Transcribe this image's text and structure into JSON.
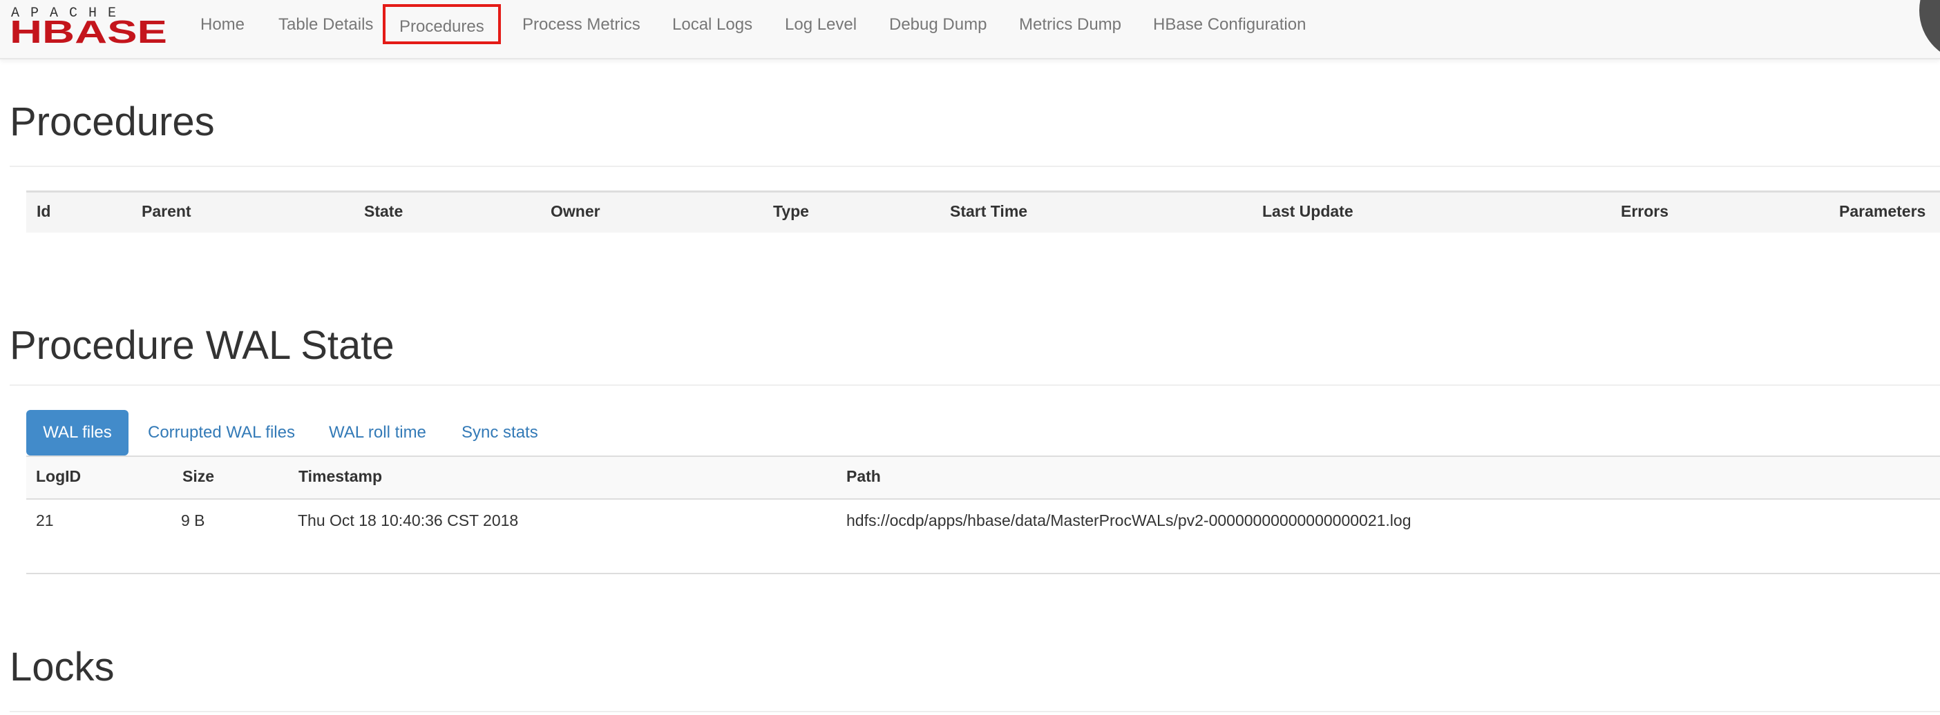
{
  "logo": {
    "top_text": "APACHE",
    "main_text": "HBASE",
    "brand_color": "#c4151c"
  },
  "nav": {
    "items": [
      {
        "label": "Home"
      },
      {
        "label": "Table Details"
      },
      {
        "label": "Procedures",
        "active": true
      },
      {
        "label": "Process Metrics"
      },
      {
        "label": "Local Logs"
      },
      {
        "label": "Log Level"
      },
      {
        "label": "Debug Dump"
      },
      {
        "label": "Metrics Dump"
      },
      {
        "label": "HBase Configuration"
      }
    ],
    "active_highlight_color": "#e41b17"
  },
  "procedures": {
    "heading": "Procedures",
    "columns": [
      "Id",
      "Parent",
      "State",
      "Owner",
      "Type",
      "Start Time",
      "Last Update",
      "Errors",
      "Parameters"
    ],
    "rows": []
  },
  "wal_state": {
    "heading": "Procedure WAL State",
    "tabs": [
      {
        "label": "WAL files",
        "active": true
      },
      {
        "label": "Corrupted WAL files"
      },
      {
        "label": "WAL roll time"
      },
      {
        "label": "Sync stats"
      }
    ],
    "tab_active_color": "#428bca",
    "columns": [
      "LogID",
      "Size",
      "Timestamp",
      "Path"
    ],
    "rows": [
      {
        "log_id": "21",
        "size": "9 B",
        "timestamp": "Thu Oct 18 10:40:36 CST 2018",
        "path": "hdfs://ocdp/apps/hbase/data/MasterProcWALs/pv2-00000000000000000021.log"
      }
    ]
  },
  "locks": {
    "heading": "Locks"
  }
}
